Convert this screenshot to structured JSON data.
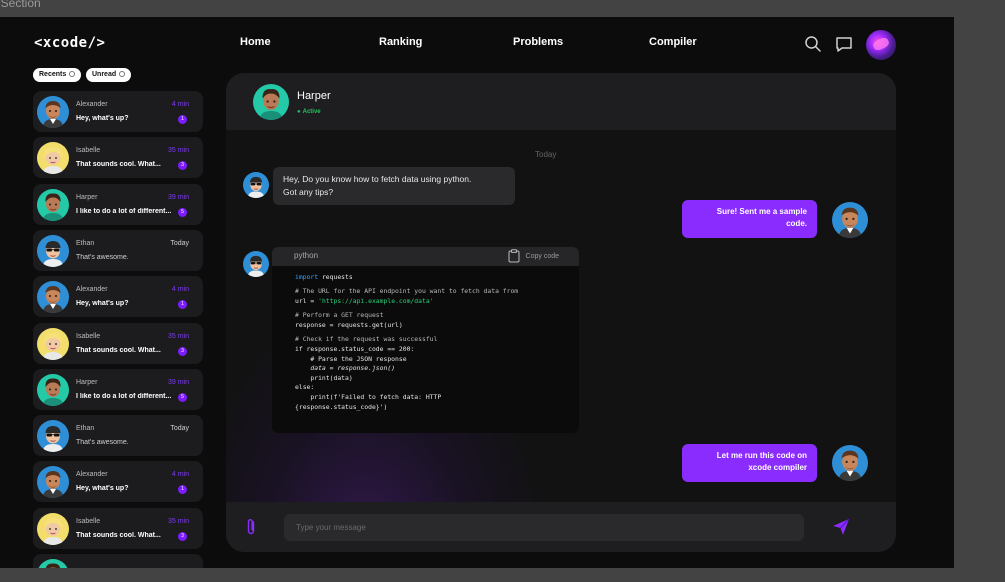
{
  "frame_label": "t Section",
  "header": {
    "logo": "<xcode/>",
    "nav": [
      "Home",
      "Ranking",
      "Problems",
      "Compiler"
    ]
  },
  "filters": [
    "Recents",
    "Unread"
  ],
  "chats": [
    {
      "name": "Alexander",
      "time": "4 min",
      "message": "Hey, what's up?",
      "badge": "1",
      "avatar": "alexander"
    },
    {
      "name": "Isabelle",
      "time": "35 min",
      "message": "That sounds cool. What...",
      "badge": "3",
      "avatar": "isabelle"
    },
    {
      "name": "Harper",
      "time": "39 min",
      "message": "I like to do a lot of different...",
      "badge": "5",
      "avatar": "harper"
    },
    {
      "name": "Ethan",
      "time": "Today",
      "message": "That's awesome.",
      "badge": "",
      "avatar": "ethan"
    },
    {
      "name": "Alexander",
      "time": "4 min",
      "message": "Hey, what's up?",
      "badge": "1",
      "avatar": "alexander"
    },
    {
      "name": "Isabelle",
      "time": "35 min",
      "message": "That sounds cool. What...",
      "badge": "3",
      "avatar": "isabelle"
    },
    {
      "name": "Harper",
      "time": "39 min",
      "message": "I like to do a lot of different...",
      "badge": "5",
      "avatar": "harper"
    },
    {
      "name": "Ethan",
      "time": "Today",
      "message": "That's awesome.",
      "badge": "",
      "avatar": "ethan"
    },
    {
      "name": "Alexander",
      "time": "4 min",
      "message": "Hey, what's up?",
      "badge": "1",
      "avatar": "alexander"
    },
    {
      "name": "Isabelle",
      "time": "35 min",
      "message": "That sounds cool. What...",
      "badge": "3",
      "avatar": "isabelle"
    },
    {
      "name": "",
      "time": "",
      "message": "",
      "badge": "",
      "avatar": "harper"
    }
  ],
  "conversation": {
    "contact_name": "Harper",
    "status": "Active",
    "day_label": "Today",
    "incoming_question": [
      "Hey, Do you know how to fetch data using python.",
      "Got any tips?"
    ],
    "reply_1": [
      "Sure! Sent me a sample",
      "code."
    ],
    "reply_2": [
      "Let me run this code on",
      "xcode compiler"
    ],
    "code_block": {
      "language": "python",
      "copy_label": "Copy code",
      "lines": [
        "import requests",
        "",
        "# The URL for the API endpoint you want to fetch data from",
        "url = 'https://api.example.com/data'",
        "",
        "# Perform a GET request",
        "response = requests.get(url)",
        "",
        "# Check if the request was successful",
        "if response.status_code == 200:",
        "    # Parse the JSON response",
        "    data = response.json()",
        "    print(data)",
        "else:",
        "    print(f'Failed to fetch data: HTTP",
        "{response.status_code}')"
      ]
    },
    "input_placeholder": "Type your message"
  },
  "colors": {
    "accent": "#8b2cff",
    "badge": "#7c1cff",
    "active": "#22c55e",
    "keyword": "#3aa0ff",
    "string": "#2ad17a"
  }
}
